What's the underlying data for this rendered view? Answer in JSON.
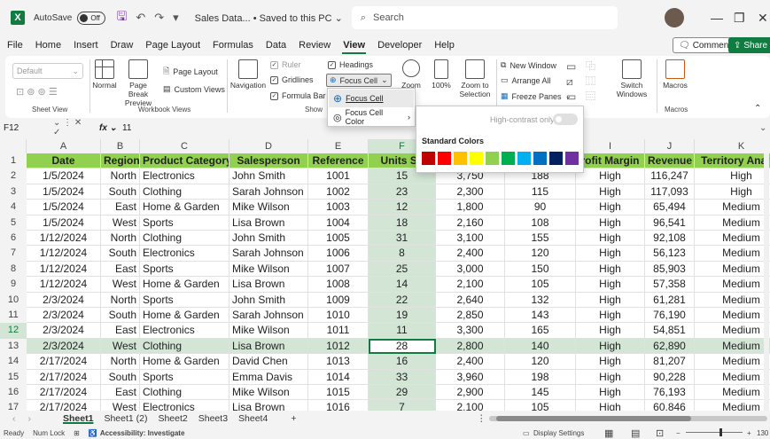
{
  "titlebar": {
    "autosave_label": "AutoSave",
    "autosave_state": "Off",
    "doc_title": "Sales Data... • Saved to this PC ⌄",
    "search_placeholder": "Search"
  },
  "menu": {
    "items": [
      "File",
      "Home",
      "Insert",
      "Draw",
      "Page Layout",
      "Formulas",
      "Data",
      "Review",
      "View",
      "Developer",
      "Help"
    ],
    "active": "View",
    "comments": "Comments",
    "share": "Share"
  },
  "ribbon": {
    "sheet_view": {
      "dropdown": "Default",
      "label": "Sheet View"
    },
    "workbook_views": {
      "normal": "Normal",
      "page_break": "Page Break Preview",
      "page_layout": "Page Layout",
      "custom_views": "Custom Views",
      "label": "Workbook Views"
    },
    "show": {
      "navigation": "Navigation",
      "ruler": "Ruler",
      "gridlines": "Gridlines",
      "formula_bar": "Formula Bar",
      "headings": "Headings",
      "focus_cell": "Focus Cell",
      "label": "Show"
    },
    "zoom": {
      "zoom": "Zoom",
      "hundred": "100%",
      "zoom_to_sel": "Zoom to Selection"
    },
    "window": {
      "new_window": "New Window",
      "arrange_all": "Arrange All",
      "freeze_panes": "Freeze Panes",
      "switch_windows": "Switch Windows"
    },
    "macros": {
      "macros": "Macros",
      "label": "Macros"
    }
  },
  "focus_menu": {
    "item1": "Focus Cell",
    "item2": "Focus Cell Color"
  },
  "color_popup": {
    "high_contrast": "High-contrast only",
    "title": "Standard Colors",
    "colors": [
      "#c00000",
      "#ff0000",
      "#ffc000",
      "#ffff00",
      "#92d050",
      "#00b050",
      "#00b0f0",
      "#0070c0",
      "#002060",
      "#7030a0"
    ]
  },
  "formula": {
    "namebox": "F12",
    "value": "11"
  },
  "grid": {
    "columns": [
      "A",
      "B",
      "C",
      "D",
      "E",
      "F",
      "G",
      "H",
      "I",
      "J",
      "K"
    ],
    "headers": [
      "Date",
      "Region",
      "Product Category",
      "Salesperson",
      "Reference",
      "Units Sc",
      "",
      "",
      "rofit Margin",
      "Revenue",
      "Territory Analys"
    ],
    "rows": [
      [
        "1/5/2024",
        "North",
        "Electronics",
        "John Smith",
        "1001",
        "15",
        "3,750",
        "188",
        "High",
        "116,247",
        "High"
      ],
      [
        "1/5/2024",
        "South",
        "Clothing",
        "Sarah Johnson",
        "1002",
        "23",
        "2,300",
        "115",
        "High",
        "117,093",
        "High"
      ],
      [
        "1/5/2024",
        "East",
        "Home & Garden",
        "Mike Wilson",
        "1003",
        "12",
        "1,800",
        "90",
        "High",
        "65,494",
        "Medium"
      ],
      [
        "1/5/2024",
        "West",
        "Sports",
        "Lisa Brown",
        "1004",
        "18",
        "2,160",
        "108",
        "High",
        "96,541",
        "Medium"
      ],
      [
        "1/12/2024",
        "North",
        "Clothing",
        "John Smith",
        "1005",
        "31",
        "3,100",
        "155",
        "High",
        "92,108",
        "Medium"
      ],
      [
        "1/12/2024",
        "South",
        "Electronics",
        "Sarah Johnson",
        "1006",
        "8",
        "2,400",
        "120",
        "High",
        "56,123",
        "Medium"
      ],
      [
        "1/12/2024",
        "East",
        "Sports",
        "Mike Wilson",
        "1007",
        "25",
        "3,000",
        "150",
        "High",
        "85,903",
        "Medium"
      ],
      [
        "1/12/2024",
        "West",
        "Home & Garden",
        "Lisa Brown",
        "1008",
        "14",
        "2,100",
        "105",
        "High",
        "57,358",
        "Medium"
      ],
      [
        "2/3/2024",
        "North",
        "Sports",
        "John Smith",
        "1009",
        "22",
        "2,640",
        "132",
        "High",
        "61,281",
        "Medium"
      ],
      [
        "2/3/2024",
        "South",
        "Home & Garden",
        "Sarah Johnson",
        "1010",
        "19",
        "2,850",
        "143",
        "High",
        "76,190",
        "Medium"
      ],
      [
        "2/3/2024",
        "East",
        "Electronics",
        "Mike Wilson",
        "1011",
        "11",
        "3,300",
        "165",
        "High",
        "54,851",
        "Medium"
      ],
      [
        "2/3/2024",
        "West",
        "Clothing",
        "Lisa Brown",
        "1012",
        "28",
        "2,800",
        "140",
        "High",
        "62,890",
        "Medium"
      ],
      [
        "2/17/2024",
        "North",
        "Home & Garden",
        "David Chen",
        "1013",
        "16",
        "2,400",
        "120",
        "High",
        "81,207",
        "Medium"
      ],
      [
        "2/17/2024",
        "South",
        "Sports",
        "Emma Davis",
        "1014",
        "33",
        "3,960",
        "198",
        "High",
        "90,228",
        "Medium"
      ],
      [
        "2/17/2024",
        "East",
        "Clothing",
        "Mike Wilson",
        "1015",
        "29",
        "2,900",
        "145",
        "High",
        "76,193",
        "Medium"
      ],
      [
        "2/17/2024",
        "West",
        "Electronics",
        "Lisa Brown",
        "1016",
        "7",
        "2,100",
        "105",
        "High",
        "60,846",
        "Medium"
      ]
    ],
    "row_numbers": [
      "1",
      "2",
      "3",
      "4",
      "5",
      "6",
      "7",
      "8",
      "9",
      "10",
      "11",
      "12",
      "13",
      "14",
      "15",
      "16",
      "17"
    ]
  },
  "tabs": {
    "items": [
      "Sheet1",
      "Sheet1 (2)",
      "Sheet2",
      "Sheet3",
      "Sheet4"
    ],
    "active": "Sheet1",
    "add": "+"
  },
  "status": {
    "ready": "Ready",
    "numlock": "Num Lock",
    "accessibility": "Accessibility: Investigate",
    "display_settings": "Display Settings",
    "zoom": "130"
  }
}
